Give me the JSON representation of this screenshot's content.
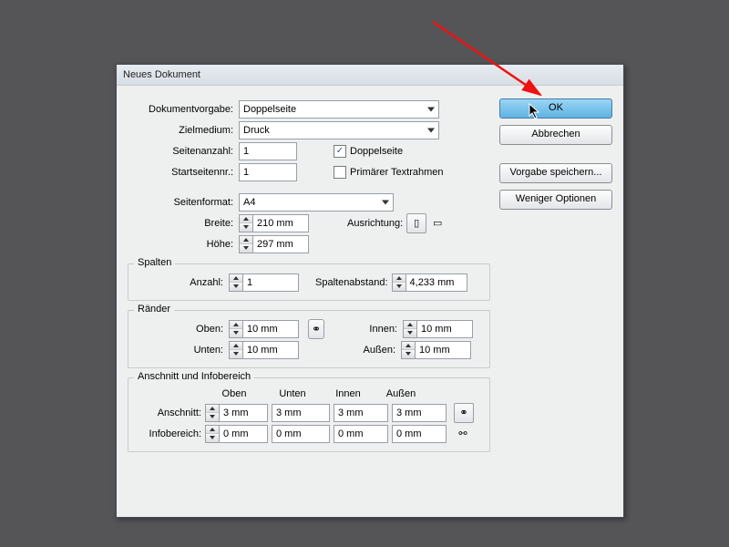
{
  "dialog": {
    "title": "Neues Dokument"
  },
  "buttons": {
    "ok": "OK",
    "cancel": "Abbrechen",
    "save_preset": "Vorgabe speichern...",
    "fewer_options": "Weniger Optionen"
  },
  "fields": {
    "preset_label": "Dokumentvorgabe:",
    "preset_value": "Doppelseite",
    "intent_label": "Zielmedium:",
    "intent_value": "Druck",
    "pages_label": "Seitenanzahl:",
    "pages_value": "1",
    "startpage_label": "Startseitennr.:",
    "startpage_value": "1",
    "facing_label": "Doppelseite",
    "primary_label": "Primärer Textrahmen",
    "pagesize_label": "Seitenformat:",
    "pagesize_value": "A4",
    "width_label": "Breite:",
    "width_value": "210 mm",
    "height_label": "Höhe:",
    "height_value": "297 mm",
    "orientation_label": "Ausrichtung:"
  },
  "columns": {
    "legend": "Spalten",
    "count_label": "Anzahl:",
    "count_value": "1",
    "gutter_label": "Spaltenabstand:",
    "gutter_value": "4,233 mm"
  },
  "margins": {
    "legend": "Ränder",
    "top_label": "Oben:",
    "bottom_label": "Unten:",
    "inside_label": "Innen:",
    "outside_label": "Außen:",
    "value": "10 mm"
  },
  "bleed": {
    "legend": "Anschnitt und Infobereich",
    "col_top": "Oben",
    "col_bottom": "Unten",
    "col_inside": "Innen",
    "col_outside": "Außen",
    "bleed_label": "Anschnitt:",
    "bleed_value": "3 mm",
    "slug_label": "Infobereich:",
    "slug_value": "0 mm"
  }
}
